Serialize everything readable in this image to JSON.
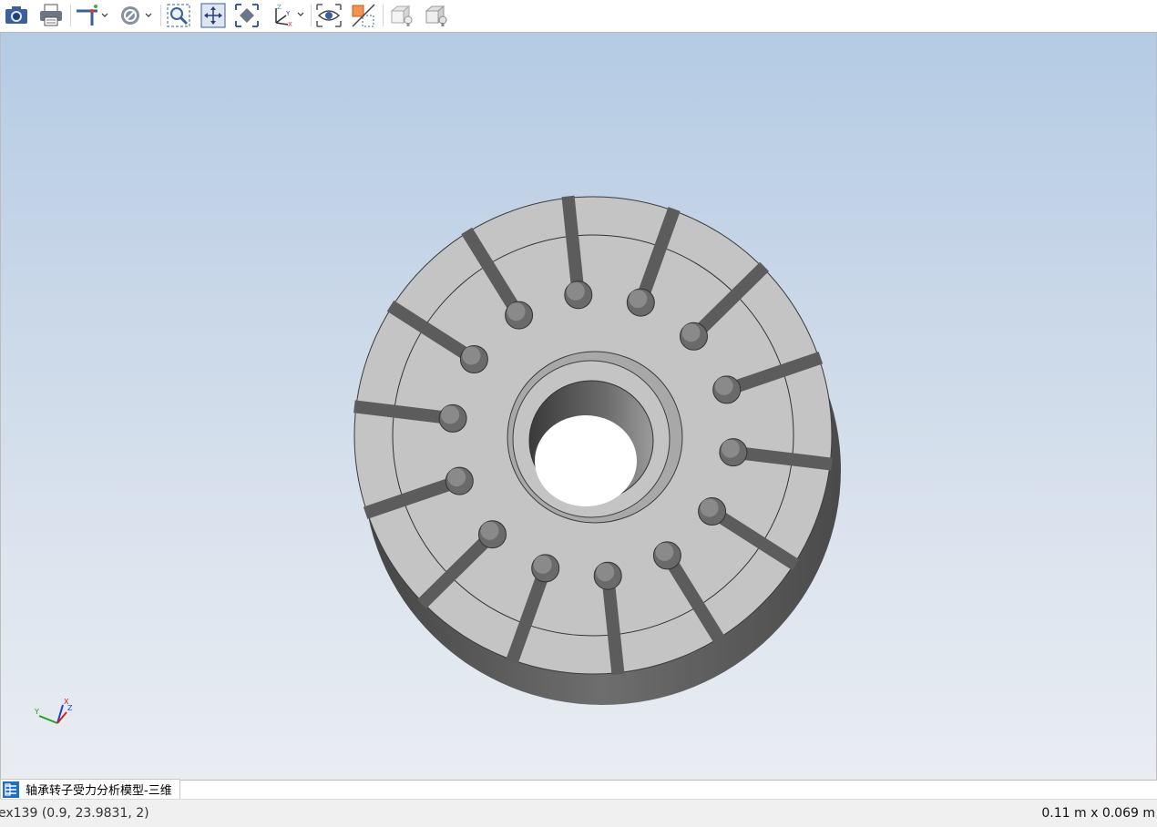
{
  "toolbar": {
    "tools": [
      {
        "name": "camera-icon",
        "label": "Screenshot"
      },
      {
        "name": "printer-icon",
        "label": "Print"
      },
      {
        "name": "probe-icon",
        "label": "Probe"
      },
      {
        "name": "no-section-icon",
        "label": "Section"
      },
      {
        "name": "zoom-box-icon",
        "label": "Zoom box"
      },
      {
        "name": "pan-icon",
        "label": "Pan"
      },
      {
        "name": "zoom-fit-icon",
        "label": "Zoom to fit"
      },
      {
        "name": "axis-orientation-icon",
        "label": "Orientation"
      },
      {
        "name": "eye-icon",
        "label": "Show"
      },
      {
        "name": "cross-section-icon",
        "label": "Hide"
      },
      {
        "name": "box-light-icon",
        "label": "Lighting"
      },
      {
        "name": "box-light-2-icon",
        "label": "Lighting 2"
      }
    ]
  },
  "triad": {
    "x": "X",
    "y": "Y",
    "z": "Z"
  },
  "document_tab": {
    "label": "轴承转子受力分析模型-三维"
  },
  "status": {
    "left": "ex139 (0.9, 23.9831, 2)",
    "right": "0.11 m x 0.069 m"
  },
  "colors": {
    "part_top": "#c4c4c4",
    "part_side": "#5a5a5a",
    "viewport_top": "#b4cbe4",
    "viewport_bottom": "#e9edf2"
  }
}
